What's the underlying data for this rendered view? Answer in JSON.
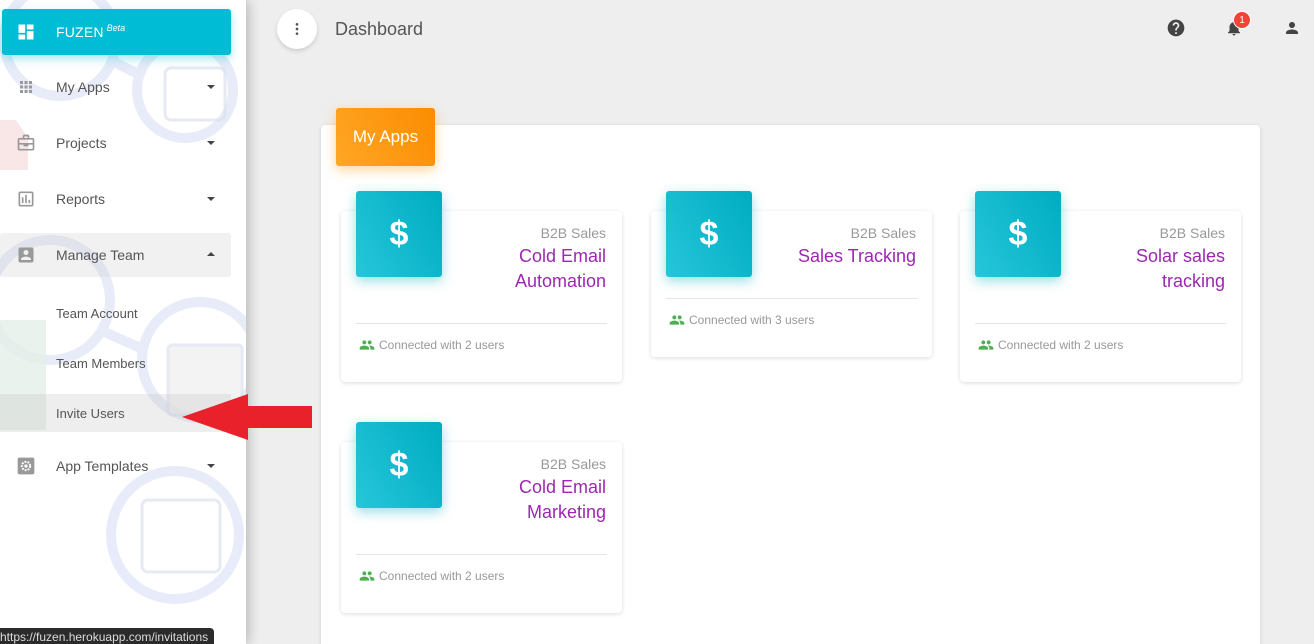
{
  "sidebar": {
    "brand": {
      "name": "FUZEN",
      "badge": "Beta"
    },
    "items": [
      {
        "label": "My Apps",
        "icon": "grid-icon"
      },
      {
        "label": "Projects",
        "icon": "briefcase-icon"
      },
      {
        "label": "Reports",
        "icon": "bar-chart-icon"
      },
      {
        "label": "Manage Team",
        "icon": "person-box-icon"
      },
      {
        "label": "App Templates",
        "icon": "gear-icon"
      }
    ],
    "sub_items": [
      {
        "label": "Team Account"
      },
      {
        "label": "Team Members"
      },
      {
        "label": "Invite Users"
      }
    ]
  },
  "status_bar": {
    "url": "https://fuzen.herokuapp.com/invitations"
  },
  "header": {
    "title": "Dashboard",
    "notification_count": "1"
  },
  "main": {
    "section_title": "My Apps",
    "apps": [
      {
        "category": "B2B Sales",
        "name_line1": "Cold Email",
        "name_line2": "Automation",
        "icon_symbol": "$",
        "footer": "Connected with 2 users"
      },
      {
        "category": "B2B Sales",
        "name_line1": "Sales Tracking",
        "name_line2": "",
        "icon_symbol": "$",
        "footer": "Connected with 3 users"
      },
      {
        "category": "B2B Sales",
        "name_line1": "Solar sales",
        "name_line2": "tracking",
        "icon_symbol": "$",
        "footer": "Connected with 2 users"
      },
      {
        "category": "B2B Sales",
        "name_line1": "Cold Email",
        "name_line2": "Marketing",
        "icon_symbol": "$",
        "footer": "Connected with 2 users"
      }
    ]
  },
  "colors": {
    "brand": "#00bcd4",
    "header_accent": "#fb8c00",
    "app_name": "#9c27b0",
    "app_icon": "#00acc1",
    "arrow": "#e8212b",
    "badge": "#f44336",
    "people_icon": "#4caf50"
  }
}
